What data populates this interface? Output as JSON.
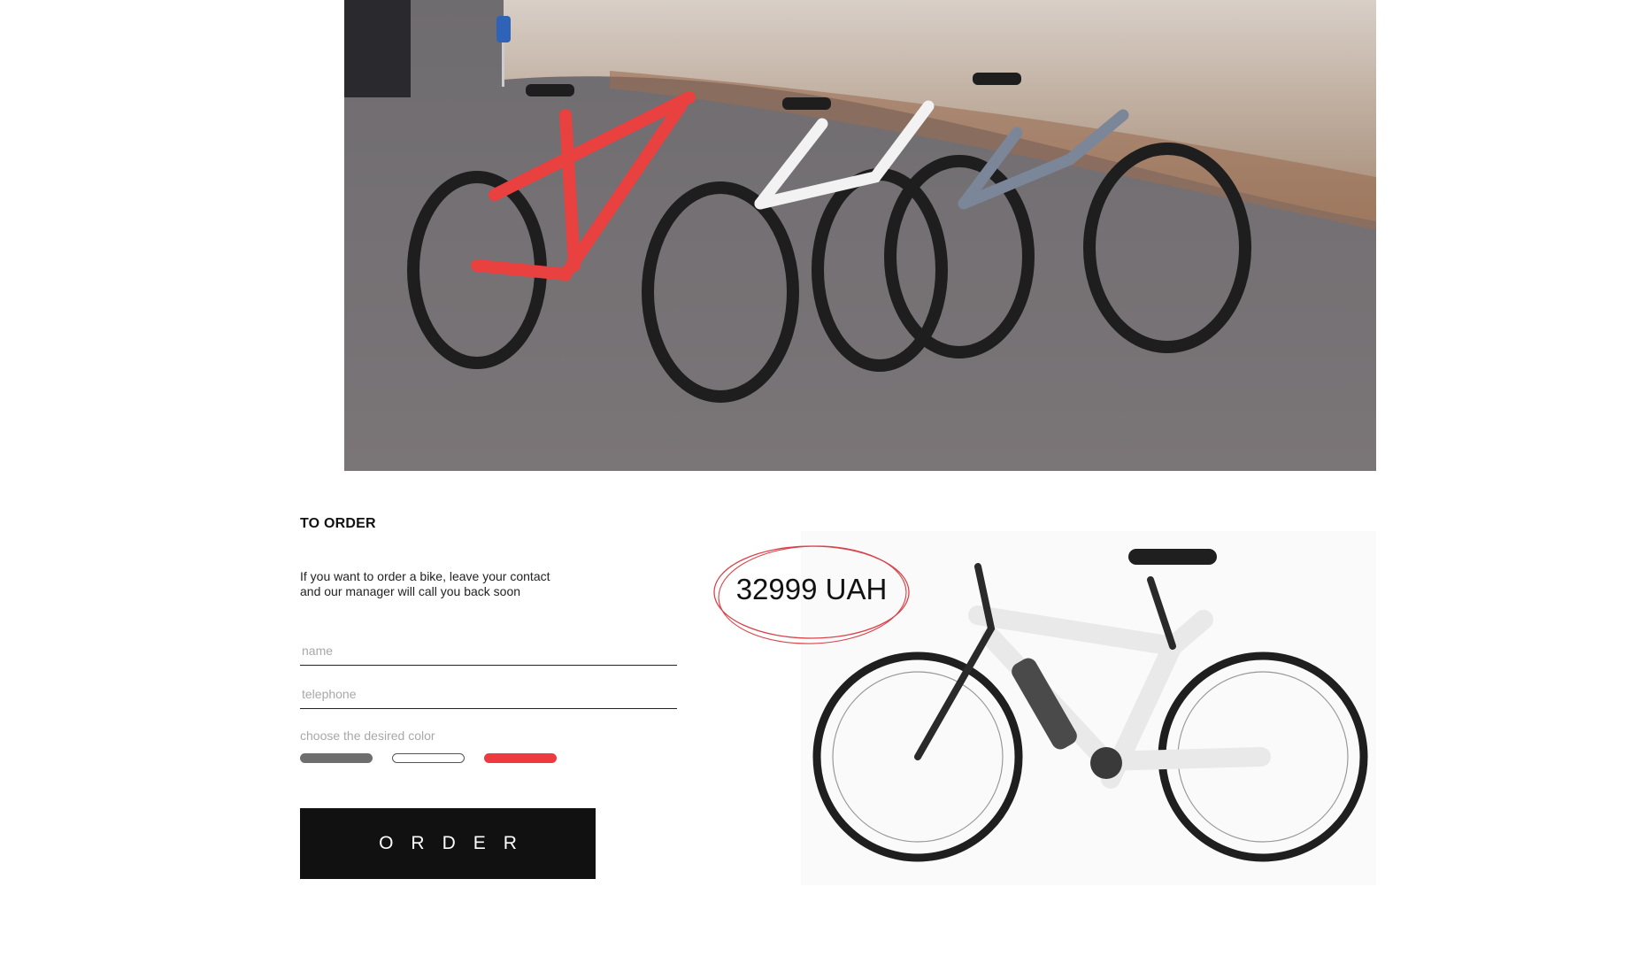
{
  "order": {
    "title": "TO ORDER",
    "description": "If you want to order a bike, leave your contact and our manager will call you back soon",
    "name_placeholder": "name",
    "telephone_placeholder": "telephone",
    "color_label": "choose the desired color",
    "colors": {
      "gray": "#6e6e6e",
      "white": "#ffffff",
      "red": "#ee3a3f"
    },
    "button_label": "ORDER"
  },
  "product": {
    "price": "32999 UAH",
    "ring_color": "#d9434a"
  },
  "icons": {
    "hero": "three-e-bikes-photo",
    "product": "white-e-bike-photo"
  }
}
